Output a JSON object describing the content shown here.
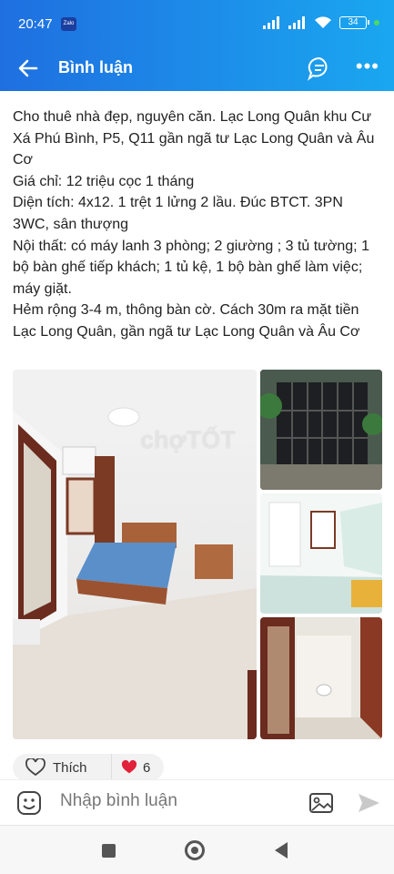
{
  "status": {
    "time": "20:47",
    "app_badge": "Zalo",
    "battery": "34"
  },
  "header": {
    "title": "Bình luận"
  },
  "post": {
    "lines": [
      "Cho thuê nhà đẹp, nguyên căn. Lạc Long Quân khu Cư Xá Phú Bình, P5, Q11 gần ngã tư Lạc Long Quân và Âu Cơ",
      "Giá chỉ: 12 triệu cọc 1 tháng",
      "Diện tích: 4x12. 1 trệt 1 lửng 2 lầu. Đúc BTCT. 3PN 3WC, sân thượng",
      "Nội thất: có máy lanh 3 phòng; 2 giường ; 3 tủ tường; 1 bộ bàn ghế tiếp khách; 1 tủ kệ, 1 bộ bàn ghế làm việc; máy giặt.",
      "Hẻm rộng 3-4 m, thông bàn cờ. Cách 30m ra mặt tiền Lạc Long Quân, gần ngã tư Lạc Long Quân và Âu Cơ"
    ],
    "watermark": "chợTỐT"
  },
  "reactions": {
    "like_label": "Thích",
    "count": "6"
  },
  "comment": {
    "placeholder": "Nhập bình luận"
  }
}
